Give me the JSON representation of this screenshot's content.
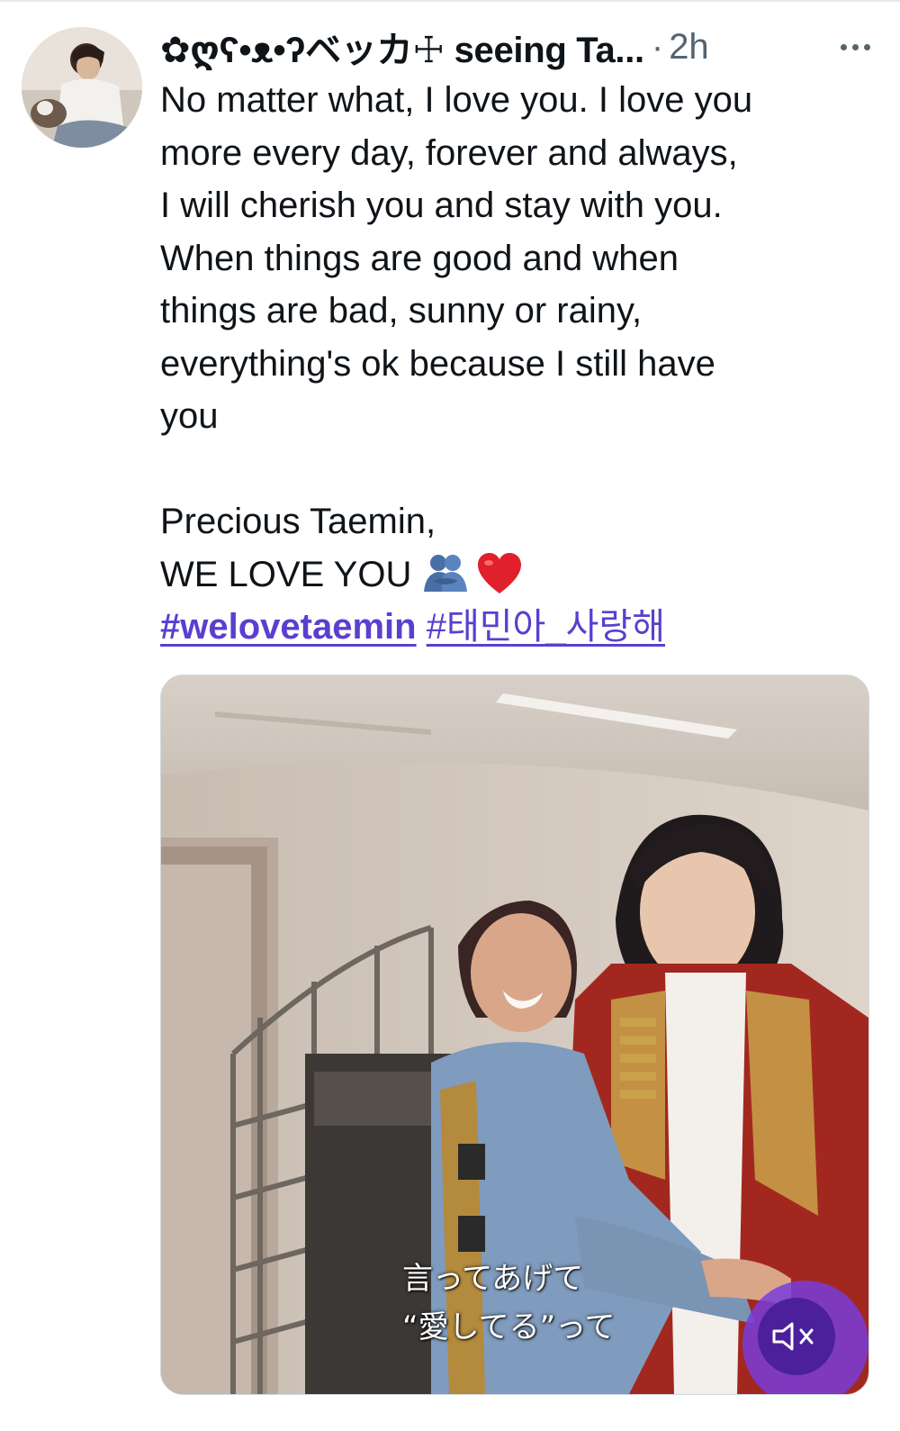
{
  "tweet": {
    "display_name": "✿ღʕ•ᴥ•ʔベッカ☩ seeing Ta...",
    "separator": "·",
    "time": "2h",
    "text_lines": [
      "No matter what, I love you. I love you",
      "more every day, forever and always,",
      "I will cherish you and stay with you.",
      "When things are good and when",
      "things are bad, sunny or rainy,",
      "everything's ok because I still have",
      "you"
    ],
    "line_precious": "Precious Taemin,",
    "line_welove": "WE LOVE YOU",
    "emojis": [
      "people-hugging-icon",
      "red-heart-icon"
    ],
    "hashtags": [
      "#welovetaemin",
      "#태민아_사랑해"
    ]
  },
  "media": {
    "type": "video",
    "subtitle_lines": [
      "言ってあげて",
      "“愛してる”って"
    ],
    "mute_icon": "speaker-muted-icon"
  },
  "colors": {
    "text": "#0f1419",
    "secondary": "#536471",
    "hashtag": "#5a3fd0",
    "mute_button": "#7b3ce0"
  }
}
